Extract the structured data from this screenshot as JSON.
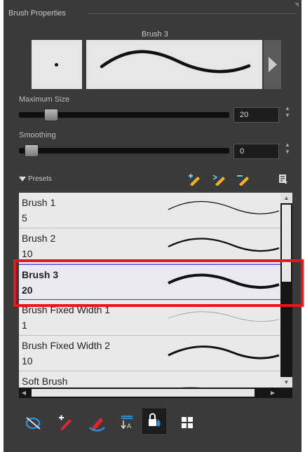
{
  "panel_title": "Brush Properties",
  "brush_name": "Brush 3",
  "max_size": {
    "label": "Maximum Size",
    "value": "20",
    "slider_fraction": 0.1
  },
  "smoothing": {
    "label": "Smoothing",
    "value": "0",
    "slider_fraction": 0.0
  },
  "presets_label": "Presets",
  "presets": [
    {
      "name": "Brush 1",
      "size": "5"
    },
    {
      "name": "Brush 2",
      "size": "10"
    },
    {
      "name": "Brush 3",
      "size": "20",
      "selected": true
    },
    {
      "name": "Brush Fixed Width 1",
      "size": "1"
    },
    {
      "name": "Brush Fixed Width 2",
      "size": "10"
    },
    {
      "name": "Soft Brush",
      "size": ""
    }
  ],
  "icons": {
    "preview_arrow": "play-triangle-icon",
    "new_preset": "new-brush-preset-icon",
    "rename_preset": "rename-brush-preset-icon",
    "delete_preset": "delete-brush-preset-icon",
    "menu": "presets-menu-icon"
  },
  "toolbar": [
    "pressure-sensitivity-icon",
    "brush-icon",
    "eraser-icon",
    "texture-icon",
    "lock-transparency-icon",
    "grid-view-icon"
  ],
  "colors": {
    "panel": "#3a3a3a",
    "highlight": "#e8161b",
    "selection_border": "#3a3cd6",
    "pencil_yellow": "#f0b12a"
  }
}
